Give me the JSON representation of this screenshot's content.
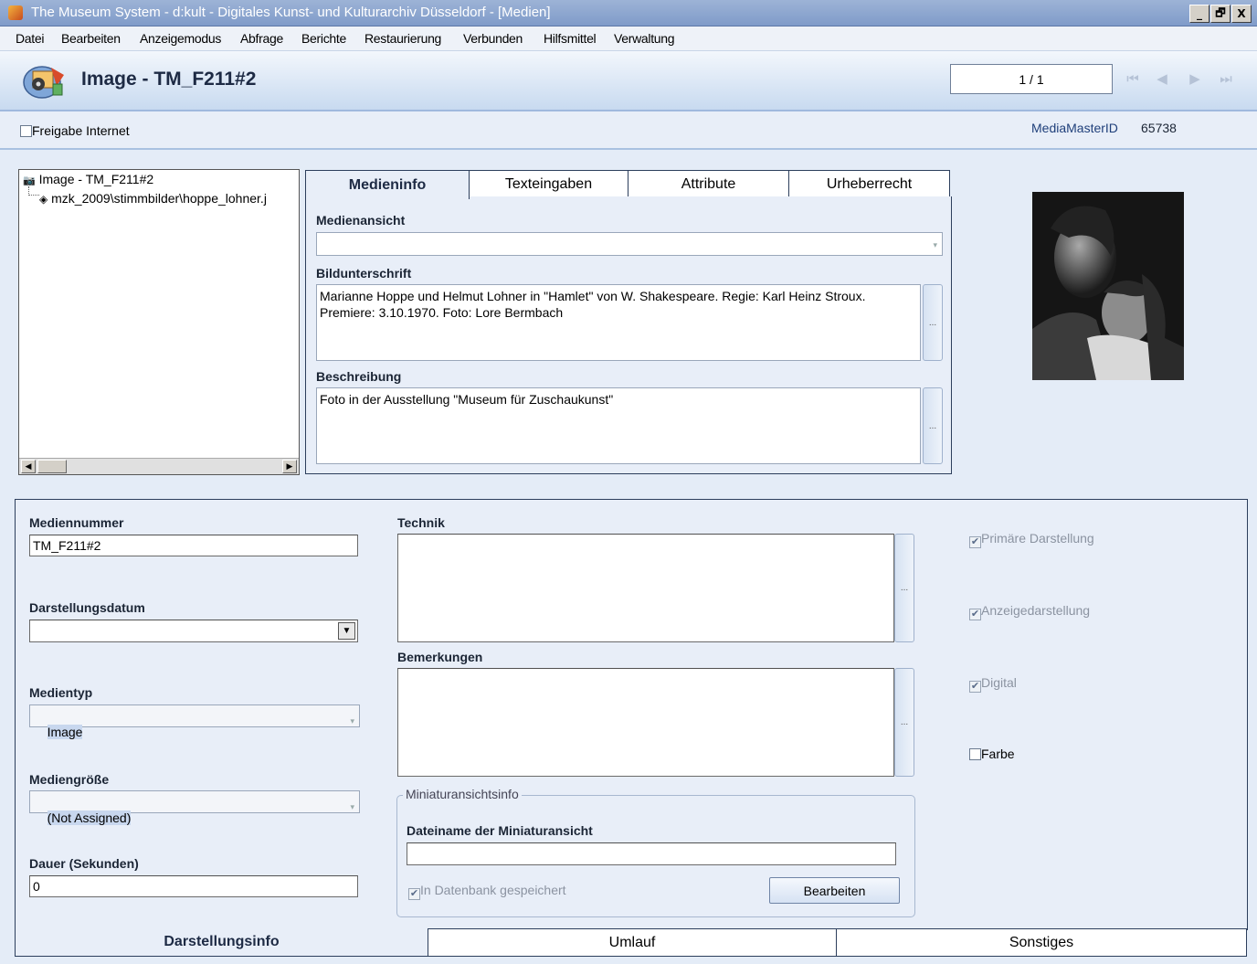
{
  "window": {
    "title": "The Museum System - d:kult - Digitales Kunst- und Kulturarchiv Düsseldorf - [Medien]",
    "controls": [
      "_",
      "🗗",
      "X"
    ]
  },
  "menu": [
    "Datei",
    "Bearbeiten",
    "Anzeigemodus",
    "Abfrage",
    "Berichte",
    "Restaurierung",
    "Verbunden",
    "Hilfsmittel",
    "Verwaltung"
  ],
  "header": {
    "title": "Image - TM_F211#2",
    "record_counter": "1 / 1",
    "nav_icons": [
      "first-record-icon",
      "previous-record-icon",
      "next-record-icon",
      "last-record-icon"
    ]
  },
  "subrow": {
    "freigabe_label": "Freigabe Internet",
    "freigabe_checked": false,
    "media_master_label": "MediaMasterID",
    "media_master_value": "65738"
  },
  "tree": {
    "root_label": "Image - TM_F211#2",
    "child_label": "mzk_2009\\stimmbilder\\hoppe_lohner.j"
  },
  "top_tabs": {
    "items": [
      "Medieninfo",
      "Texteingaben",
      "Attribute",
      "Urheberrecht"
    ],
    "active": "Medieninfo"
  },
  "medieninfo": {
    "medienansicht_label": "Medienansicht",
    "medienansicht_value": "",
    "bildunterschrift_label": "Bildunterschrift",
    "bildunterschrift_value": "Marianne Hoppe und Helmut Lohner in \"Hamlet\" von W. Shakespeare. Regie: Karl Heinz Stroux.\nPremiere: 3.10.1970. Foto: Lore Bermbach",
    "beschreibung_label": "Beschreibung",
    "beschreibung_value": "Foto in der Ausstellung \"Museum für Zuschaukunst\"",
    "ellipsis": "..."
  },
  "lower": {
    "mediennummer_label": "Mediennummer",
    "mediennummer_value": "TM_F211#2",
    "darstellungsdatum_label": "Darstellungsdatum",
    "darstellungsdatum_value": "",
    "medientyp_label": "Medientyp",
    "medientyp_value": "Image",
    "mediengroesse_label": "Mediengröße",
    "mediengroesse_value": "(Not Assigned)",
    "dauer_label": "Dauer (Sekunden)",
    "dauer_value": "0",
    "technik_label": "Technik",
    "technik_value": "",
    "bemerkungen_label": "Bemerkungen",
    "bemerkungen_value": "",
    "miniatur_group_label": "Miniaturansichtsinfo",
    "dateiname_label": "Dateiname der Miniaturansicht",
    "dateiname_value": "",
    "in_datenbank_label": "In Datenbank gespeichert",
    "bearbeiten_label": "Bearbeiten",
    "checkboxes": {
      "primaere": {
        "label": "Primäre Darstellung",
        "checked": true
      },
      "anzeige": {
        "label": "Anzeigedarstellung",
        "checked": true
      },
      "digital": {
        "label": "Digital",
        "checked": true
      },
      "farbe": {
        "label": "Farbe",
        "checked": false
      }
    }
  },
  "bottom_tabs": {
    "items": [
      "Darstellungsinfo",
      "Umlauf",
      "Sonstiges"
    ],
    "active": "Darstellungsinfo"
  },
  "colors": {
    "titlebar": "#8aa5d0",
    "panel": "#e8eef8",
    "border": "#2c3e5c"
  }
}
